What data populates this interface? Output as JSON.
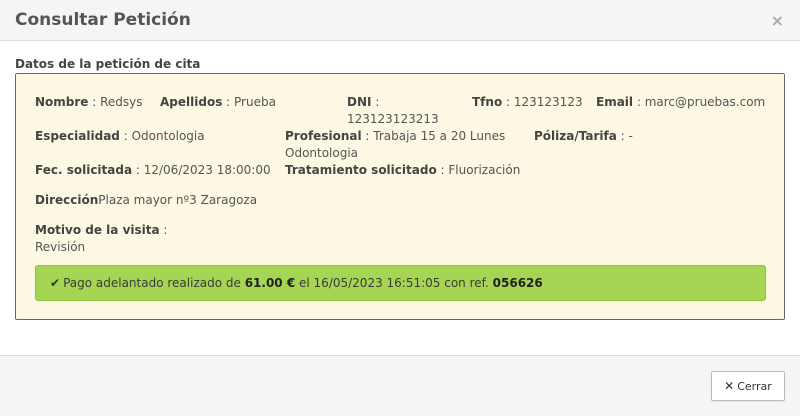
{
  "modal": {
    "title": "Consultar Petición",
    "close_symbol": "×"
  },
  "section": {
    "title": "Datos de la petición de cita"
  },
  "details": {
    "nombre_label": "Nombre",
    "nombre": "Redsys",
    "apellidos_label": "Apellidos",
    "apellidos": "Prueba",
    "dni_label": "DNI",
    "dni": "123123123213",
    "tfno_label": "Tfno",
    "tfno": "123123123",
    "email_label": "Email",
    "email": "marc@pruebas.com",
    "especialidad_label": "Especialidad",
    "especialidad": "Odontologia",
    "profesional_label": "Profesional",
    "profesional": "Trabaja 15 a 20 Lunes Odontologia",
    "poliza_label": "Póliza/Tarifa",
    "poliza": "-",
    "fecha_label": "Fec. solicitada",
    "fecha": "12/06/2023 18:00:00",
    "tratamiento_label": "Tratamiento solicitado",
    "tratamiento": "Fluorización",
    "direccion_label": "Dirección",
    "direccion": "Plaza mayor nº3 Zaragoza",
    "motivo_label": "Motivo de la visita",
    "motivo": "Revisión"
  },
  "payment_alert": {
    "icon": "check-icon",
    "text_before": "Pago adelantado realizado de",
    "amount": "61.00 €",
    "text_middle": "el 16/05/2023 16:51:05 con ref.",
    "reference": "056626",
    "color": "#a5d653"
  },
  "footer": {
    "close_icon": "close-icon",
    "close_label": "Cerrar"
  },
  "colors": {
    "panel_background": "#fcf8e3",
    "alert_background": "#a5d653"
  }
}
